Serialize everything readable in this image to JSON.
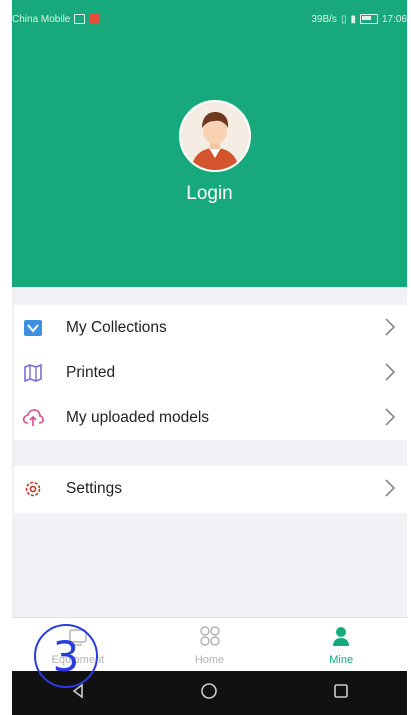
{
  "status_bar": {
    "carrier": "China Mobile",
    "speed": "39B/s",
    "time": "17:06"
  },
  "profile": {
    "avatar_icon": "user-avatar-icon",
    "login_label": "Login"
  },
  "menu": {
    "items": [
      {
        "label": "My Collections",
        "icon": "collections-icon"
      },
      {
        "label": "Printed",
        "icon": "printed-map-icon"
      },
      {
        "label": "My uploaded models",
        "icon": "cloud-upload-icon"
      }
    ],
    "settings": {
      "label": "Settings",
      "icon": "gear-icon"
    }
  },
  "bottom_nav": {
    "items": [
      {
        "label": "Equipment",
        "icon": "equipment-icon",
        "active": false
      },
      {
        "label": "Home",
        "icon": "home-grid-icon",
        "active": false
      },
      {
        "label": "Mine",
        "icon": "person-icon",
        "active": true
      }
    ]
  },
  "watermark": {
    "number": "3"
  },
  "colors": {
    "primary": "#17a97b",
    "background": "#f1f1f5",
    "accent_blue": "#3d8fe0",
    "accent_purple": "#7e6bd6",
    "accent_pink": "#d94b8c",
    "accent_red": "#b83a2a"
  }
}
